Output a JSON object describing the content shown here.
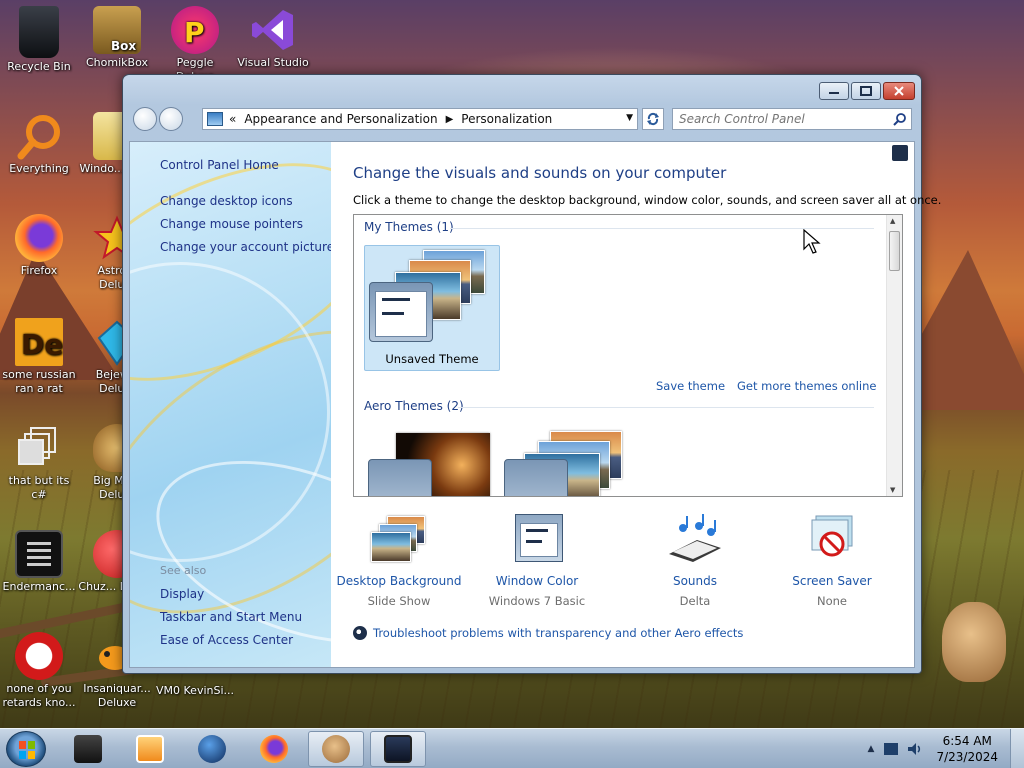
{
  "desktop": {
    "icons": [
      {
        "label": "Recycle Bin"
      },
      {
        "label": "ChomikBox"
      },
      {
        "label": "Peggle Deluxe"
      },
      {
        "label": "Visual Studio"
      },
      {
        "label": "Everything"
      },
      {
        "label": "Windo... Ma..."
      },
      {
        "label": "Firefox"
      },
      {
        "label": "Astro... Delu..."
      },
      {
        "label": "some russian ran a rat"
      },
      {
        "label": "Bejew... Delu..."
      },
      {
        "label": "that but its c#"
      },
      {
        "label": "Big Mo... Delu..."
      },
      {
        "label": "Endermanc..."
      },
      {
        "label": "Chuz... Del0..."
      },
      {
        "label": "none of you retards kno..."
      },
      {
        "label": "Insaniquar... Deluxe"
      },
      {
        "label": "VM0 KevinSi..."
      }
    ]
  },
  "window": {
    "address": {
      "overflow": "«",
      "segments": [
        "Appearance and Personalization",
        "Personalization"
      ]
    },
    "search": {
      "placeholder": "Search Control Panel"
    },
    "sidebar": {
      "home": "Control Panel Home",
      "links": [
        "Change desktop icons",
        "Change mouse pointers",
        "Change your account picture"
      ],
      "see_also_title": "See also",
      "see_also": [
        "Display",
        "Taskbar and Start Menu",
        "Ease of Access Center"
      ]
    },
    "main": {
      "heading": "Change the visuals and sounds on your computer",
      "subtext": "Click a theme to change the desktop background, window color, sounds, and screen saver all at once.",
      "my_themes_header": "My Themes (1)",
      "selected_theme": "Unsaved Theme",
      "save_theme": "Save theme",
      "get_more": "Get more themes online",
      "aero_header": "Aero Themes (2)",
      "bottom": [
        {
          "title": "Desktop Background",
          "sub": "Slide Show"
        },
        {
          "title": "Window Color",
          "sub": "Windows 7 Basic"
        },
        {
          "title": "Sounds",
          "sub": "Delta"
        },
        {
          "title": "Screen Saver",
          "sub": "None"
        }
      ],
      "troubleshoot": "Troubleshoot problems with transparency and other Aero effects"
    }
  },
  "taskbar": {
    "clock": {
      "time": "6:54 AM",
      "date": "7/23/2024"
    }
  },
  "colors": {
    "link": "#1e56a8",
    "heading": "#1e3f86",
    "sidebar_link": "#1e3287"
  }
}
